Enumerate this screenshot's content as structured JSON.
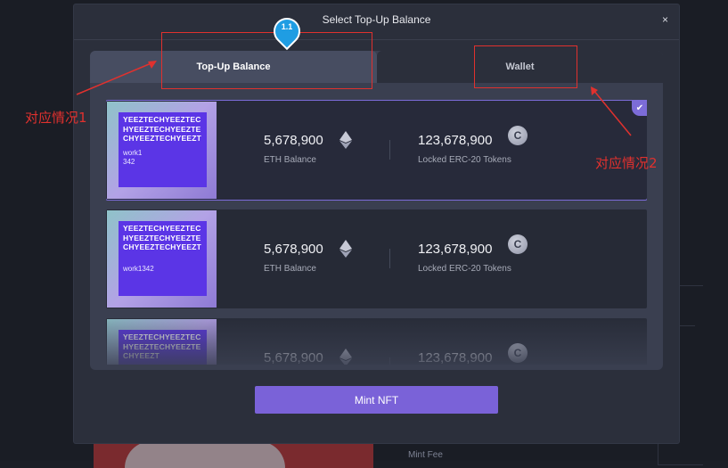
{
  "modal": {
    "title": "Select Top-Up Balance",
    "close": "×",
    "tabs": {
      "topup": "Top-Up Balance",
      "wallet": "Wallet"
    },
    "mint_button": "Mint NFT"
  },
  "cards": [
    {
      "name": "YEEZTECHYEEZTECHYEEZTECHYEEZTECHYEEZTECHYEEZT",
      "sub": "work1\n342",
      "eth_value": "5,678,900",
      "eth_label": "ETH Balance",
      "token_value": "123,678,900",
      "token_label": "Locked ERC-20 Tokens",
      "selected": true
    },
    {
      "name": "YEEZTECHYEEZTECHYEEZTECHYEEZTECHYEEZTECHYEEZT",
      "sub": "work1342",
      "eth_value": "5,678,900",
      "eth_label": "ETH Balance",
      "token_value": "123,678,900",
      "token_label": "Locked ERC-20 Tokens",
      "selected": false
    },
    {
      "name": "YEEZTECHYEEZTECHYEEZTECHYEEZTECHYEEZT",
      "sub": "",
      "eth_value": "5,678,900",
      "eth_label": "",
      "token_value": "123,678,900",
      "token_label": "",
      "selected": false
    }
  ],
  "background": {
    "mint_fee": "Mint Fee"
  },
  "annotations": {
    "pin_label": "1.1",
    "label1": "对应情况1",
    "label2": "对应情况2"
  },
  "colors": {
    "accent": "#7a62d8",
    "annotation": "#e0312e",
    "pin": "#1f9de3"
  },
  "icons": {
    "eth": "ethereum-icon",
    "coin": "coin-c-icon",
    "check": "check-icon",
    "close": "close-icon"
  }
}
